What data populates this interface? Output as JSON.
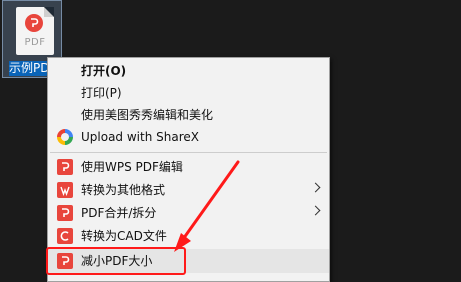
{
  "desktop_icon": {
    "filetype_text": "PDF",
    "label": "示例PDF"
  },
  "menu": {
    "items": [
      {
        "label": "打开(O)",
        "bold": true,
        "icon": "",
        "submenu": false
      },
      {
        "label": "打印(P)",
        "icon": "",
        "submenu": false
      },
      {
        "label": "使用美图秀秀编辑和美化",
        "icon": "",
        "submenu": false
      },
      {
        "label": "Upload with ShareX",
        "icon": "sharex-icon",
        "submenu": false
      },
      {
        "label": "使用WPS PDF编辑",
        "icon": "wps-pdf-icon",
        "submenu": false
      },
      {
        "label": "转换为其他格式",
        "icon": "wps-pdf-icon",
        "submenu": true
      },
      {
        "label": "PDF合并/拆分",
        "icon": "wps-pdf-icon",
        "submenu": true
      },
      {
        "label": "转换为CAD文件",
        "icon": "wps-pdf-icon",
        "submenu": false
      },
      {
        "label": "减小PDF大小",
        "icon": "wps-pdf-icon",
        "submenu": false
      }
    ]
  },
  "colors": {
    "annotation_red": "#ff1a1a",
    "wps_red": "#e8453c",
    "selection_blue": "#0a64b8"
  }
}
